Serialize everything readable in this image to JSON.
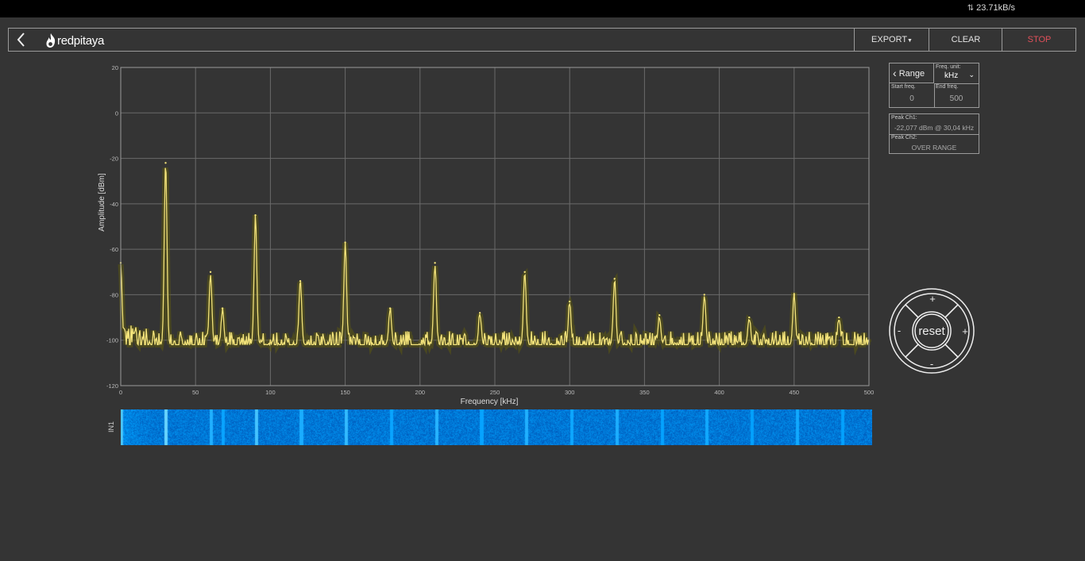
{
  "statusbar": {
    "transfer_rate": "23.71kB/s",
    "icon": "up-down-arrows-icon"
  },
  "header": {
    "back_icon": "chevron-left-icon",
    "logo_text": "redpitaya",
    "export_label": "EXPORT",
    "clear_label": "CLEAR",
    "stop_label": "STOP"
  },
  "range_panel": {
    "range_label": "Range",
    "freq_unit_label": "Freq. unit:",
    "freq_unit_value": "kHz",
    "start_freq_label": "Start freq.",
    "start_freq_value": "0",
    "end_freq_label": "End freq.",
    "end_freq_value": "500"
  },
  "peaks_panel": {
    "peak_ch1_label": "Peak Ch1:",
    "peak_ch1_value": "-22,077 dBm @ 30,04 kHz",
    "peak_ch2_label": "Peak Ch2:",
    "peak_ch2_value": "OVER RANGE"
  },
  "navigator": {
    "reset_label": "reset",
    "plus": "+",
    "minus": "-"
  },
  "waterfall": {
    "channel_label": "IN1"
  },
  "colors": {
    "background": "#343434",
    "trace": "#f2e27a",
    "grid": "#6a6a6a",
    "stop": "#e0505a"
  },
  "chart_data": {
    "type": "line",
    "xlabel": "Frequency [kHz]",
    "ylabel": "Amplitude [dBm]",
    "xlim": [
      0,
      500
    ],
    "ylim": [
      -120,
      20
    ],
    "xticks": [
      0,
      50,
      100,
      150,
      200,
      250,
      300,
      350,
      400,
      450,
      500
    ],
    "yticks": [
      20,
      0,
      -20,
      -40,
      -60,
      -80,
      -100,
      -120
    ],
    "grid": true,
    "noise_floor": -102,
    "series": [
      {
        "peaks": [
          {
            "x": 0,
            "y": -66
          },
          {
            "x": 30,
            "y": -22
          },
          {
            "x": 60,
            "y": -70
          },
          {
            "x": 68,
            "y": -86
          },
          {
            "x": 90,
            "y": -45
          },
          {
            "x": 120,
            "y": -74
          },
          {
            "x": 150,
            "y": -57
          },
          {
            "x": 180,
            "y": -86
          },
          {
            "x": 210,
            "y": -66
          },
          {
            "x": 240,
            "y": -88
          },
          {
            "x": 270,
            "y": -70
          },
          {
            "x": 300,
            "y": -83
          },
          {
            "x": 330,
            "y": -73
          },
          {
            "x": 360,
            "y": -89
          },
          {
            "x": 390,
            "y": -80
          },
          {
            "x": 420,
            "y": -90
          },
          {
            "x": 450,
            "y": -80
          },
          {
            "x": 480,
            "y": -90
          }
        ]
      }
    ]
  }
}
